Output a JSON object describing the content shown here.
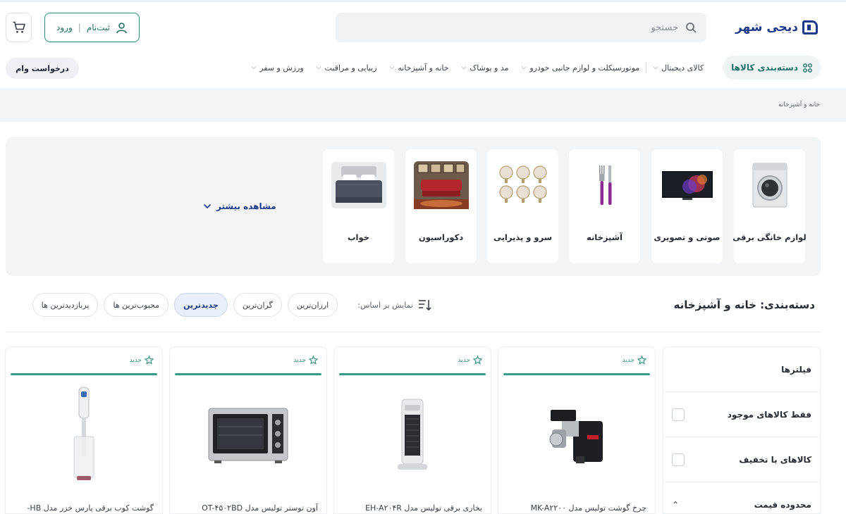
{
  "header": {
    "logo_text": "دیجی شهر",
    "search_placeholder": "جستجو",
    "login": {
      "signup_label": "ثبت‌نام",
      "separator": "|",
      "login_label": "ورود"
    },
    "loan_button": "درخواست وام"
  },
  "nav": {
    "categories_button": "دسته‌بندی کالاها",
    "items": [
      {
        "label": "کالای دیجیتال"
      },
      {
        "label": "موتورسیکلت و لوازم جانبی خودرو"
      },
      {
        "label": "مد و پوشاک"
      },
      {
        "label": "خانه و آشپزخانه"
      },
      {
        "label": "زیبایی و مراقبت"
      },
      {
        "label": "ورزش و سفر"
      }
    ]
  },
  "breadcrumb": "خانه و آشپزخانه",
  "category_cards": [
    {
      "label": "لوازم خانگی برقی",
      "icon": "washing-machine"
    },
    {
      "label": "صوتی و تصویری",
      "icon": "television"
    },
    {
      "label": "آشپزخانه",
      "icon": "fork-knife"
    },
    {
      "label": "سرو و پذیرایی",
      "icon": "glassware"
    },
    {
      "label": "دکوراسیون",
      "icon": "interior-decor"
    },
    {
      "label": "خواب",
      "icon": "bed"
    }
  ],
  "see_more": "مشاهده بیشتر",
  "listing": {
    "title": "دسته‌بندی: خانه و آشپزخانه",
    "sort_label": "نمایش بر اساس:",
    "sort_options": [
      {
        "label": "ارزان‌ترین",
        "active": false
      },
      {
        "label": "گران‌ترین",
        "active": false
      },
      {
        "label": "جدیدترین",
        "active": true
      },
      {
        "label": "محبوب‌ترین ها",
        "active": false
      },
      {
        "label": "پربازدیدترین ها",
        "active": false
      }
    ]
  },
  "filters": {
    "title": "فیلترها",
    "only_available": "فقط کالاهای موجود",
    "discounted": "کالاهای با تخفیف",
    "price_range": "محدوده قیمت"
  },
  "products": [
    {
      "badge": "جدید",
      "name": "چرخ گوشت توليس مدل MK-A۲۲۰۰",
      "image": "meat-grinder"
    },
    {
      "badge": "جدید",
      "name": "بخاری برقی توليس مدل EH-A۲۰۴R",
      "image": "electric-heater"
    },
    {
      "badge": "جدید",
      "name": "آون توستر توليس مدل OT-۴۵۰۲BD",
      "image": "toaster-oven"
    },
    {
      "badge": "جدید",
      "name": "گوشت کوب برقی پارس خزر مدل HB-",
      "image": "hand-blender"
    }
  ],
  "colors": {
    "accent_teal": "#2f8f83",
    "brand_blue": "#1d3a8a"
  }
}
